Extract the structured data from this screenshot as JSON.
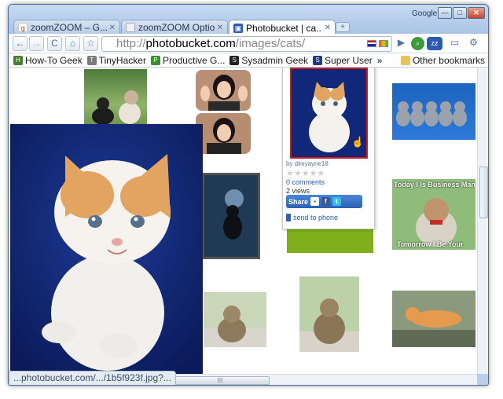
{
  "window": {
    "brand_label": "Google",
    "buttons": {
      "minimize": "—",
      "maximize": "□",
      "close": "✕"
    }
  },
  "tabs": [
    {
      "title": "zoomZOOM – G...",
      "icon": "google-favicon",
      "active": false
    },
    {
      "title": "zoomZOOM Options",
      "icon": "page-favicon",
      "active": false
    },
    {
      "title": "Photobucket | ca...",
      "icon": "photobucket-favicon",
      "active": true
    }
  ],
  "toolbar": {
    "back": "←",
    "forward": "→",
    "reload": "C",
    "home": "⌂",
    "star": "☆",
    "url_scheme": "http://",
    "url_host": "photobucket.com",
    "url_path": "/images/cats/",
    "go": "▶"
  },
  "bookmarks": [
    {
      "label": "How-To Geek",
      "icon": "htg-icon",
      "color": "#4a7a2e"
    },
    {
      "label": "TinyHacker",
      "icon": "tinyhacker-icon",
      "color": "#7a7a7a"
    },
    {
      "label": "Productive G...",
      "icon": "pg-icon",
      "color": "#3c8d2f"
    },
    {
      "label": "Sysadmin Geek",
      "icon": "sg-icon",
      "color": "#222222"
    },
    {
      "label": "Super User",
      "icon": "superuser-icon",
      "color": "#1f3b7a"
    }
  ],
  "bookmarks_more": "»",
  "other_bookmarks": "Other bookmarks",
  "hover_card": {
    "author": "by dimyayne18",
    "stars": "★★★★★",
    "comments": "0 comments",
    "views": "2 views",
    "share_label": "Share",
    "send_to_phone": "send to phone"
  },
  "thumbnails": {
    "business_top": "Today I Is Business Man",
    "business_bottom": "Tomorrow I Be Your"
  },
  "status_text": "...photobucket.com/.../1b5f923f.jpg?...",
  "scrollbar_grip": "III"
}
